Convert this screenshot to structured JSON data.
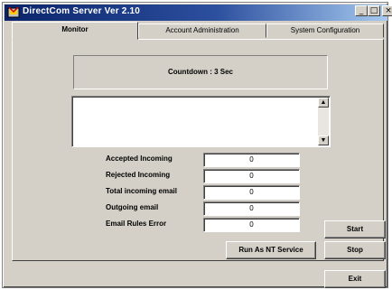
{
  "window": {
    "title": "DirectCom Server Ver 2.10",
    "controls": {
      "minimize": "_",
      "maximize": "□",
      "close": "×"
    }
  },
  "tabs": [
    {
      "label": "Monitor",
      "active": true
    },
    {
      "label": "Account Administration",
      "active": false
    },
    {
      "label": "System Configuration",
      "active": false
    }
  ],
  "monitor": {
    "countdown": "Countdown : 3 Sec",
    "log_text": "",
    "stats": [
      {
        "label": "Accepted Incoming",
        "value": "0"
      },
      {
        "label": "Rejected Incoming",
        "value": "0"
      },
      {
        "label": "Total incoming email",
        "value": "0"
      },
      {
        "label": "Outgoing email",
        "value": "0"
      },
      {
        "label": "Email Rules Error",
        "value": "0"
      }
    ]
  },
  "buttons": {
    "start": "Start",
    "stop": "Stop",
    "run_as_service": "Run As NT Service",
    "exit": "Exit"
  },
  "icons": {
    "scroll_up": "▲",
    "scroll_down": "▼"
  }
}
